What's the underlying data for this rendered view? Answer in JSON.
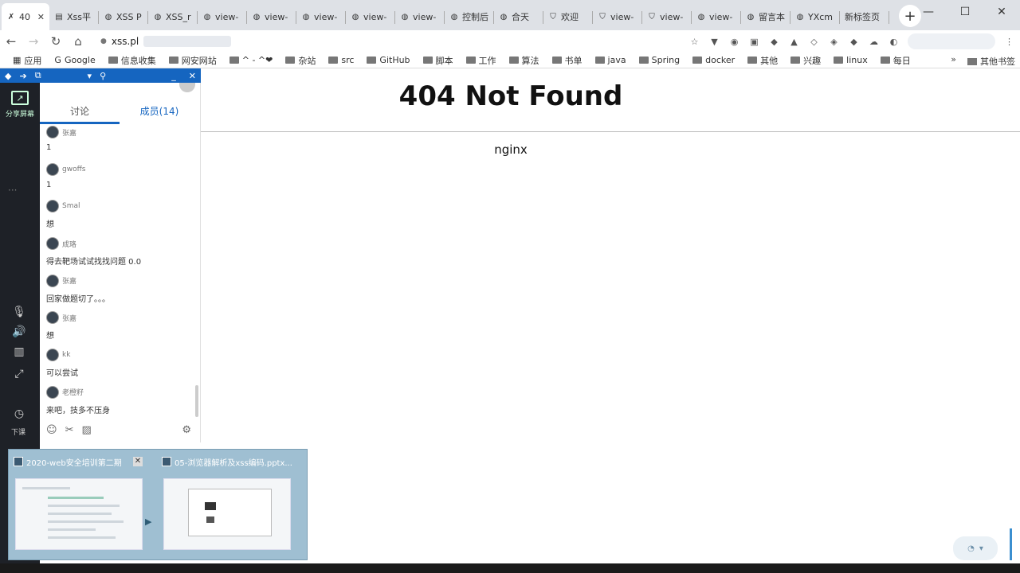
{
  "browser": {
    "tabs": [
      {
        "label": "40",
        "icon": "nginx-icon",
        "active": true
      },
      {
        "label": "Xss平",
        "icon": "page-icon"
      },
      {
        "label": "XSS P",
        "icon": "globe-icon"
      },
      {
        "label": "XSS_r",
        "icon": "globe-icon"
      },
      {
        "label": "view-",
        "icon": "globe-icon"
      },
      {
        "label": "view-",
        "icon": "globe-icon"
      },
      {
        "label": "view-",
        "icon": "globe-icon"
      },
      {
        "label": "view-",
        "icon": "globe-icon"
      },
      {
        "label": "view-",
        "icon": "globe-icon"
      },
      {
        "label": "控制后",
        "icon": "globe-icon"
      },
      {
        "label": "合天",
        "icon": "globe-icon"
      },
      {
        "label": "欢迎",
        "icon": "shield-icon"
      },
      {
        "label": "view-",
        "icon": "shield-icon"
      },
      {
        "label": "view-",
        "icon": "shield-icon"
      },
      {
        "label": "view-",
        "icon": "globe-icon"
      },
      {
        "label": "留言本",
        "icon": "globe-icon"
      },
      {
        "label": "YXcm",
        "icon": "globe-icon"
      },
      {
        "label": "新标签页",
        "icon": ""
      }
    ],
    "url": "xss.pl",
    "bookmarks": [
      "应用",
      "Google",
      "信息收集",
      "网安网站",
      "^ - ^❤",
      "杂站",
      "src",
      "GitHub",
      "脚本",
      "工作",
      "算法",
      "书单",
      "java",
      "Spring",
      "docker",
      "其他",
      "兴趣",
      "linux",
      "每日"
    ],
    "bookmarks_more": "»",
    "other_bookmarks": "其他书签"
  },
  "page": {
    "title": "404 Not Found",
    "server": "nginx"
  },
  "app_sidebar": {
    "share_label": "分享屏幕",
    "leave_label": "下课"
  },
  "chat": {
    "tabs": [
      "讨论",
      "成员(14)"
    ],
    "messages": [
      {
        "name": "张嘉",
        "text": "1"
      },
      {
        "name": "gwoffs",
        "text": "1"
      },
      {
        "name": "Smal",
        "text": "想"
      },
      {
        "name": "成珞",
        "text": "得去靶场试试找找问题  0.0"
      },
      {
        "name": "张嘉",
        "text": "回家做题切了。。。"
      },
      {
        "name": "张嘉",
        "text": "想"
      },
      {
        "name": "kk",
        "text": "可以尝试"
      },
      {
        "name": "老橙籽",
        "text": "来吧，技多不压身"
      }
    ]
  },
  "taskbar_previews": [
    {
      "title": "2020-web安全培训第二期"
    },
    {
      "title": "05-浏览器解析及xss编码.pptx..."
    }
  ],
  "colors": {
    "accent": "#1565c0",
    "sidebar_bg": "#1e2127",
    "tabbar_bg": "#dee1e6"
  }
}
